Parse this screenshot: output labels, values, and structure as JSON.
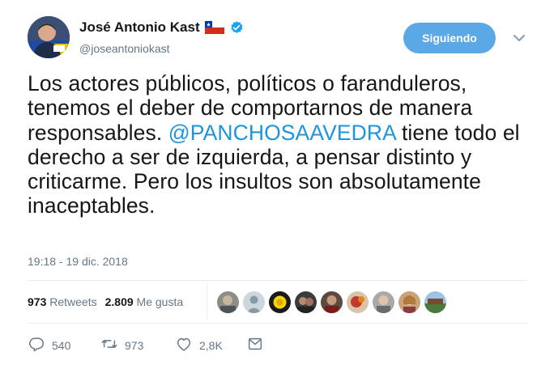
{
  "author": {
    "name": "José Antonio Kast",
    "handle": "@joseantoniokast"
  },
  "follow_button": {
    "label": "Siguiendo"
  },
  "tweet": {
    "text_before": "Los actores públicos, políticos o faranduleros, tenemos el deber de comportarnos de manera responsables. ",
    "mention": "@PANCHOSAAVEDRA",
    "text_after": " tiene todo el derecho a ser de izquierda, a pensar distinto y criticarme. Pero los insultos son absolutamente inaceptables.",
    "timestamp": "19:18 - 19 dic. 2018"
  },
  "stats": {
    "retweets_count": "973",
    "retweets_label": "Retweets",
    "likes_count": "2.809",
    "likes_label": "Me gusta"
  },
  "actions": {
    "reply_count": "540",
    "retweet_count": "973",
    "like_count": "2,8K"
  },
  "colors": {
    "accent": "#5aa9e6",
    "mention": "#1b95e0",
    "muted": "#657786"
  },
  "icons": [
    "chile-flag-icon",
    "verified-icon",
    "chevron-down-icon",
    "reply-icon",
    "retweet-icon",
    "heart-icon",
    "message-icon"
  ]
}
